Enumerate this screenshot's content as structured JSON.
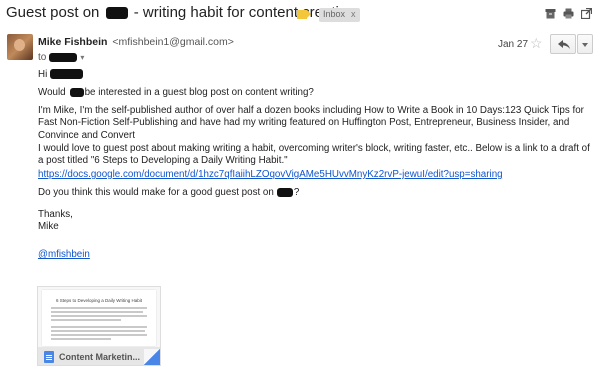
{
  "subject": {
    "prefix": "Guest post on",
    "suffix": " - writing habit for content creation",
    "label_color": "#f4c63a",
    "inbox_chip": "Inbox",
    "chip_close": "x"
  },
  "toolbar_icons": [
    "archive-icon",
    "print-icon",
    "open-in-new-window-icon"
  ],
  "sender": {
    "name": "Mike Fishbein",
    "email": "<mfishbein1@gmail.com>",
    "to_prefix": "to",
    "date": "Jan 27",
    "star": "☆"
  },
  "body": {
    "greeting": "Hi",
    "would_a": "Would",
    "would_b": "be interested in a guest blog post on content writing?",
    "intro": "I'm Mike, I'm the self-published author of over half a dozen books including How to Write a Book in 10 Days:123 Quick Tips for Fast Non-Fiction Self-Publishing and have had my writing featured on Huffington Post, Entrepreneur, Business Insider, and Convince and Convert",
    "love": "I would love to guest post about making writing a habit, overcoming writer's block, writing faster, etc.. Below is a link to a draft of a post titled \"6 Steps to Developing a Daily Writing Habit.\"",
    "link": "https://docs.google.com/document/d/1hzc7qfIaiihLZOqovVigAMe5HUvvMnyKz2rvP-jewuI/edit?usp=sharing",
    "think_a": "Do you think this would make for a good guest post on",
    "think_b": "?",
    "thanks": "Thanks,",
    "signoff": "Mike",
    "handle": "@mfishbein"
  },
  "attachment": {
    "doc_title": "6 Steps to Developing a Daily Writing Habit",
    "file_name": "Content Marketin...",
    "icon_color": "#4a86e8"
  },
  "colors": {
    "link": "#1155cc",
    "redaction": "#111111"
  }
}
